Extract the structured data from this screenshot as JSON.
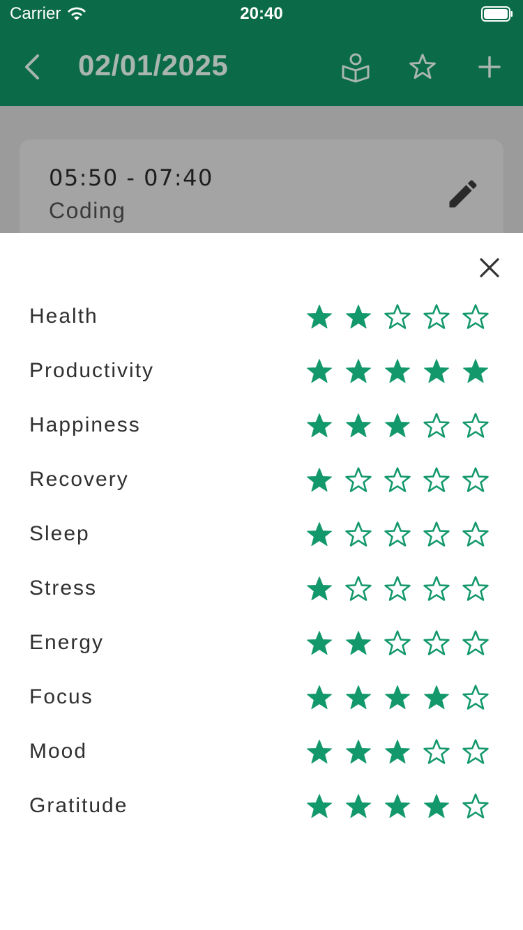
{
  "status_bar": {
    "carrier": "Carrier",
    "time": "20:40"
  },
  "app_bar": {
    "title": "02/01/2025",
    "icons": [
      "back-icon",
      "book-user-icon",
      "star-outline-icon",
      "plus-icon"
    ]
  },
  "entry": {
    "time_range": "05:50 - 07:40",
    "activity": "Coding"
  },
  "colors": {
    "header": "#0b6b48",
    "star": "#13986c",
    "backdrop": "#9a9a9a"
  },
  "ratings": [
    {
      "label": "Health",
      "value": 2
    },
    {
      "label": "Productivity",
      "value": 5
    },
    {
      "label": "Happiness",
      "value": 3
    },
    {
      "label": "Recovery",
      "value": 1
    },
    {
      "label": "Sleep",
      "value": 1
    },
    {
      "label": "Stress",
      "value": 1
    },
    {
      "label": "Energy",
      "value": 2
    },
    {
      "label": "Focus",
      "value": 4
    },
    {
      "label": "Mood",
      "value": 3
    },
    {
      "label": "Gratitude",
      "value": 4
    }
  ],
  "rating_max": 5
}
